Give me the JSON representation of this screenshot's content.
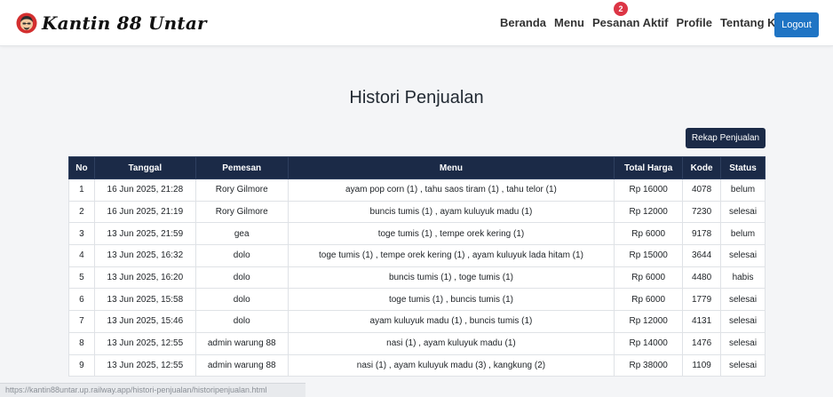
{
  "brand": {
    "name": "Kantin 88 Untar",
    "logo_icon": "chef-avatar-icon",
    "logo_colors": {
      "ring": "#d32f2f",
      "face": "#f2c9a0",
      "hair": "#2b2b2b"
    }
  },
  "nav": {
    "items": [
      {
        "label": "Beranda"
      },
      {
        "label": "Menu"
      },
      {
        "label": "Pesanan Aktif",
        "badge": "2"
      },
      {
        "label": "Profile"
      },
      {
        "label": "Tentang Kami"
      }
    ],
    "logout_label": "Logout"
  },
  "page": {
    "title": "Histori Penjualan",
    "rekap_label": "Rekap Penjualan"
  },
  "table": {
    "headers": [
      "No",
      "Tanggal",
      "Pemesan",
      "Menu",
      "Total Harga",
      "Kode",
      "Status"
    ],
    "rows": [
      [
        "1",
        "16 Jun 2025, 21:28",
        "Rory Gilmore",
        "ayam pop corn (1) , tahu saos tiram (1) , tahu telor (1)",
        "Rp 16000",
        "4078",
        "belum"
      ],
      [
        "2",
        "16 Jun 2025, 21:19",
        "Rory Gilmore",
        "buncis tumis (1) , ayam kuluyuk madu (1)",
        "Rp 12000",
        "7230",
        "selesai"
      ],
      [
        "3",
        "13 Jun 2025, 21:59",
        "gea",
        "toge tumis (1) , tempe orek kering (1)",
        "Rp 6000",
        "9178",
        "belum"
      ],
      [
        "4",
        "13 Jun 2025, 16:32",
        "dolo",
        "toge tumis (1) , tempe orek kering (1) , ayam kuluyuk lada hitam (1)",
        "Rp 15000",
        "3644",
        "selesai"
      ],
      [
        "5",
        "13 Jun 2025, 16:20",
        "dolo",
        "buncis tumis (1) , toge tumis (1)",
        "Rp 6000",
        "4480",
        "habis"
      ],
      [
        "6",
        "13 Jun 2025, 15:58",
        "dolo",
        "toge tumis (1) , buncis tumis (1)",
        "Rp 6000",
        "1779",
        "selesai"
      ],
      [
        "7",
        "13 Jun 2025, 15:46",
        "dolo",
        "ayam kuluyuk madu (1) , buncis tumis (1)",
        "Rp 12000",
        "4131",
        "selesai"
      ],
      [
        "8",
        "13 Jun 2025, 12:55",
        "admin warung 88",
        "nasi (1) , ayam kuluyuk madu (1)",
        "Rp 14000",
        "1476",
        "selesai"
      ],
      [
        "9",
        "13 Jun 2025, 12:55",
        "admin warung 88",
        "nasi (1) , ayam kuluyuk madu (3) , kangkung (2)",
        "Rp 38000",
        "1109",
        "selesai"
      ]
    ]
  },
  "status_bar": {
    "url": "https://kantin88untar.up.railway.app/histori-penjualan/historipenjualan.html"
  },
  "colors": {
    "navy": "#1b2a47",
    "logout_blue": "#1f74c4",
    "badge_red": "#dc3545",
    "background": "#f4f5f7"
  }
}
